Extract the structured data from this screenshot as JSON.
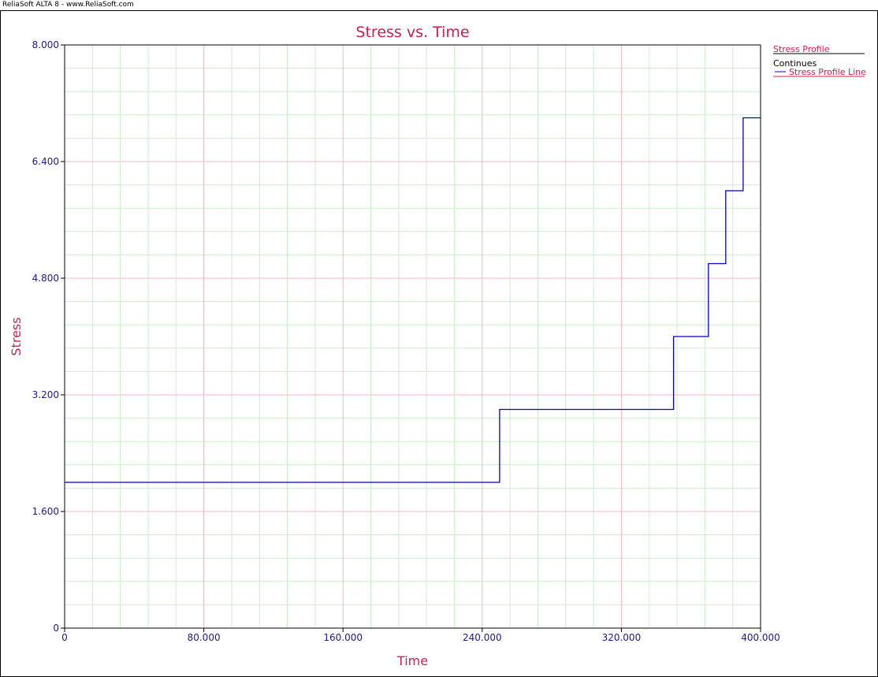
{
  "app": {
    "banner": "ReliaSoft ALTA 8 - www.ReliaSoft.com"
  },
  "legend": {
    "header": "Stress Profile",
    "subheader": "Continues",
    "entry": "Stress Profile Line"
  },
  "colors": {
    "title": "#d81b4a",
    "ticks": "#1a1a8c",
    "series": "#0000cc",
    "major_grid": "#f2b8c0",
    "minor_grid": "#c9f0c9"
  },
  "chart_data": {
    "type": "line",
    "title": "Stress vs. Time",
    "xlabel": "Time",
    "ylabel": "Stress",
    "xlim": [
      0,
      400
    ],
    "ylim": [
      0,
      8
    ],
    "x_ticks": [
      0,
      80,
      160,
      240,
      320,
      400
    ],
    "x_tick_labels": [
      "0",
      "80.000",
      "160.000",
      "240.000",
      "320.000",
      "400.000"
    ],
    "y_ticks": [
      0,
      1.6,
      3.2,
      4.8,
      6.4,
      8
    ],
    "y_tick_labels": [
      "0",
      "1.600",
      "3.200",
      "4.800",
      "6.400",
      "8.000"
    ],
    "grid": true,
    "legend_position": "top-right",
    "series": [
      {
        "name": "Stress Profile Line",
        "step": true,
        "points": [
          [
            0,
            2
          ],
          [
            250,
            2
          ],
          [
            250,
            3
          ],
          [
            350,
            3
          ],
          [
            350,
            4
          ],
          [
            370,
            4
          ],
          [
            370,
            5
          ],
          [
            380,
            5
          ],
          [
            380,
            6
          ],
          [
            390,
            6
          ],
          [
            390,
            7
          ],
          [
            400,
            7
          ]
        ]
      }
    ]
  }
}
